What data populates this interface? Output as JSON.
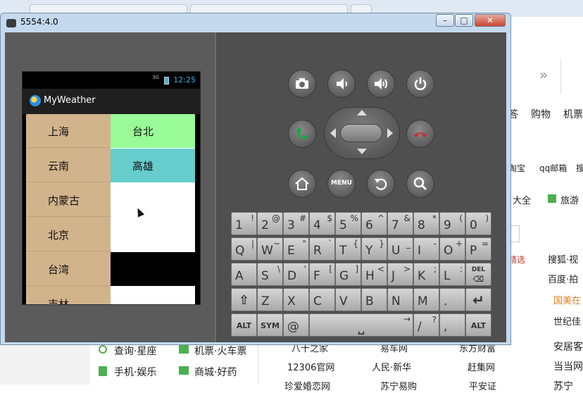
{
  "background": {
    "right_top_text": "»",
    "right_nav": [
      "答",
      "购物",
      "机票"
    ],
    "right_links1": [
      "淘宝",
      "qq邮箱",
      "搜"
    ],
    "right_links2": [
      "大全",
      "旅游"
    ],
    "right_promos": [
      "精选",
      "搜狐·视",
      "百度·拍",
      "国美在",
      "世纪佳"
    ],
    "bottom_left": [
      {
        "label": "查询·星座"
      },
      {
        "label": "手机·娱乐"
      }
    ],
    "bottom_mid": [
      {
        "label": "机票·火车票"
      },
      {
        "label": "商城·好药"
      }
    ],
    "bottom_links": [
      "八十之家",
      "易车网",
      "东方财富",
      "12306官网",
      "人民·新华",
      "赶集网",
      "珍爱婚恋网",
      "苏宁易购",
      "平安证"
    ],
    "bottom_right": [
      "安居客",
      "当当网",
      "苏宁"
    ]
  },
  "emulator": {
    "title": "5554:4.0",
    "minimize": "–",
    "maximize": "□",
    "close": "✕"
  },
  "phone": {
    "status_time": "12:25",
    "status_network": "3G",
    "app_title": "MyWeather",
    "provinces": [
      "上海",
      "云南",
      "内蒙古",
      "北京",
      "台湾",
      "吉林"
    ],
    "cities": [
      {
        "name": "台北",
        "bg": "#98fb98"
      },
      {
        "name": "高雄",
        "bg": "#66cdcc"
      },
      {
        "name": "",
        "bg": "#ffffff"
      },
      {
        "name": "",
        "bg": "#ffffff"
      },
      {
        "name": "",
        "bg": "#000000"
      },
      {
        "name": "",
        "bg": "#ffffff"
      }
    ]
  },
  "controls": {
    "row1": [
      "camera-icon",
      "volume-down-icon",
      "volume-up-icon",
      "power-icon"
    ],
    "call": "call-icon",
    "end_call": "end-call-icon",
    "row3": [
      "home-icon",
      "MENU",
      "back-icon",
      "search-icon"
    ]
  },
  "keyboard": {
    "row1": [
      {
        "k": "1",
        "a": "!"
      },
      {
        "k": "2",
        "a": "@"
      },
      {
        "k": "3",
        "a": "#"
      },
      {
        "k": "4",
        "a": "$"
      },
      {
        "k": "5",
        "a": "%"
      },
      {
        "k": "6",
        "a": "^"
      },
      {
        "k": "7",
        "a": "&"
      },
      {
        "k": "8",
        "a": "*"
      },
      {
        "k": "9",
        "a": "("
      },
      {
        "k": "0",
        "a": ")"
      }
    ],
    "row2": [
      {
        "k": "Q",
        "a": "|"
      },
      {
        "k": "W",
        "a": "~"
      },
      {
        "k": "E",
        "a": "\""
      },
      {
        "k": "R",
        "a": "`"
      },
      {
        "k": "T",
        "a": "{"
      },
      {
        "k": "Y",
        "a": "}"
      },
      {
        "k": "U",
        "a": "_"
      },
      {
        "k": "I",
        "a": "-"
      },
      {
        "k": "O",
        "a": "+"
      },
      {
        "k": "P",
        "a": "="
      }
    ],
    "row3": [
      {
        "k": "A",
        "a": ""
      },
      {
        "k": "S",
        "a": "\\"
      },
      {
        "k": "D",
        "a": "'"
      },
      {
        "k": "F",
        "a": "["
      },
      {
        "k": "G",
        "a": "]"
      },
      {
        "k": "H",
        "a": "<"
      },
      {
        "k": "J",
        "a": ">"
      },
      {
        "k": "K",
        "a": ";"
      },
      {
        "k": "L",
        "a": ":"
      },
      {
        "k": "DEL",
        "a": ""
      }
    ],
    "row4": [
      {
        "k": "⇧",
        "a": ""
      },
      {
        "k": "Z",
        "a": ""
      },
      {
        "k": "X",
        "a": ""
      },
      {
        "k": "C",
        "a": ""
      },
      {
        "k": "V",
        "a": ""
      },
      {
        "k": "B",
        "a": ""
      },
      {
        "k": "N",
        "a": ""
      },
      {
        "k": "M",
        "a": ""
      },
      {
        "k": ".",
        "a": ""
      },
      {
        "k": "↵",
        "a": ""
      }
    ],
    "row5": [
      {
        "k": "ALT",
        "a": ""
      },
      {
        "k": "SYM",
        "a": ""
      },
      {
        "k": "@",
        "a": ""
      },
      {
        "k": "␣",
        "a": "→"
      },
      {
        "k": "/",
        "a": "?"
      },
      {
        "k": ",",
        "a": ""
      },
      {
        "k": "ALT",
        "a": ""
      }
    ]
  }
}
